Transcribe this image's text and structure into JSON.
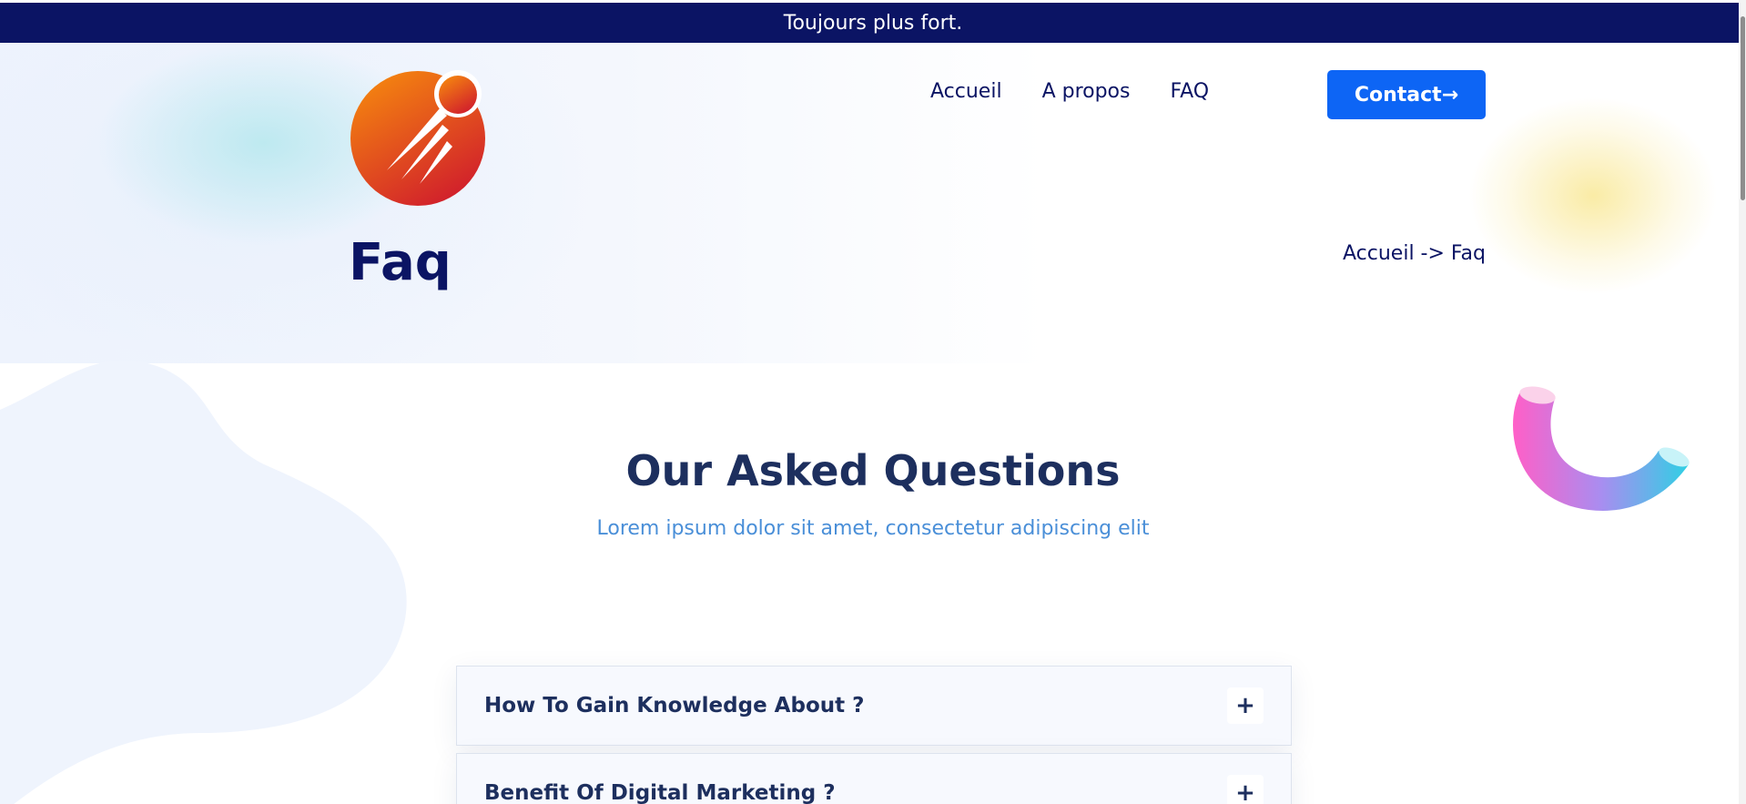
{
  "topbar": {
    "text": "Toujours plus fort."
  },
  "nav": {
    "items": [
      {
        "label": "Accueil"
      },
      {
        "label": "A propos"
      },
      {
        "label": "FAQ"
      }
    ],
    "contact_label": "Contact→"
  },
  "hero": {
    "title": "Faq",
    "breadcrumb": "Accueil -> Faq"
  },
  "section": {
    "heading": "Our Asked Questions",
    "subtitle": "Lorem ipsum dolor sit amet, consectetur adipiscing elit"
  },
  "faq": {
    "items": [
      {
        "question": "How To Gain Knowledge About ?",
        "toggle": "+"
      },
      {
        "question": "Benefit Of Digital Marketing ?",
        "toggle": "+"
      }
    ]
  },
  "colors": {
    "topbar": "#0b1464",
    "primary_button": "#0d65f5",
    "heading": "#1d2f5e",
    "subtitle": "#4a8fd8",
    "logo_gradient": [
      "#f5860f",
      "#cf1a2d"
    ]
  },
  "icons": {
    "logo": "comet-logo",
    "decoration": "torus-shape",
    "faq_toggle": "plus-icon"
  }
}
